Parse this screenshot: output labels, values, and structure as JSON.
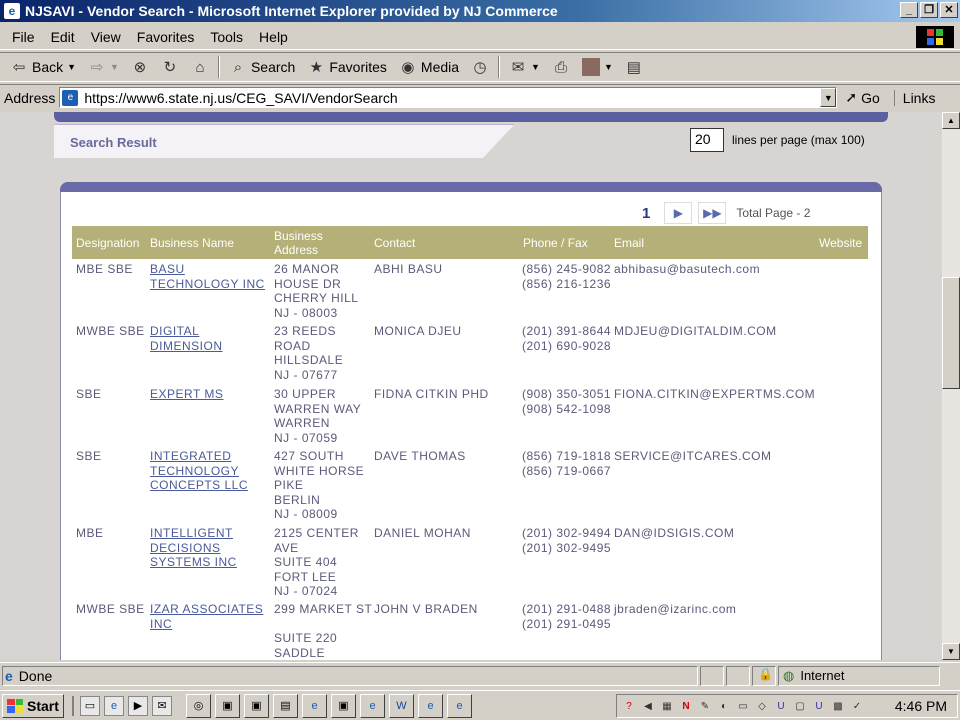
{
  "window": {
    "title": "NJSAVI - Vendor Search - Microsoft Internet Explorer provided by NJ Commerce"
  },
  "menu": [
    "File",
    "Edit",
    "View",
    "Favorites",
    "Tools",
    "Help"
  ],
  "toolbar": {
    "back": "Back",
    "search": "Search",
    "favorites": "Favorites",
    "media": "Media"
  },
  "address": {
    "label": "Address",
    "url": "https://www6.state.nj.us/CEG_SAVI/VendorSearch",
    "go": "Go",
    "links": "Links"
  },
  "page": {
    "section_title": "Search Result",
    "lines_per_page_value": "20",
    "lines_per_page_label": "lines per page (max 100)",
    "current_page": "1",
    "total_pages": "Total Page - 2"
  },
  "table": {
    "headers": [
      "Designation",
      "Business Name",
      "Business Address",
      "Contact",
      "Phone / Fax",
      "Email",
      "Website"
    ],
    "rows": [
      {
        "designation": "MBE SBE",
        "name": [
          "BASU",
          "TECHNOLOGY INC"
        ],
        "address": [
          "26 MANOR",
          "HOUSE DR",
          "CHERRY HILL",
          "NJ - 08003"
        ],
        "contact": "ABHI  BASU",
        "phones": [
          "(856) 245-9082",
          "(856) 216-1236"
        ],
        "email": "abhibasu@basutech.com"
      },
      {
        "designation": "MWBE SBE",
        "name": [
          "DIGITAL",
          "DIMENSION"
        ],
        "address": [
          "23 REEDS",
          "ROAD",
          "HILLSDALE",
          "NJ - 07677"
        ],
        "contact": "MONICA  DJEU",
        "phones": [
          "(201) 391-8644",
          "(201) 690-9028"
        ],
        "email": "MDJEU@DIGITALDIM.COM"
      },
      {
        "designation": "SBE",
        "name": [
          "EXPERT MS"
        ],
        "address": [
          "30 UPPER",
          "WARREN WAY",
          "WARREN",
          "NJ - 07059"
        ],
        "contact": "FIDNA  CITKIN PHD",
        "phones": [
          "(908) 350-3051",
          "(908) 542-1098"
        ],
        "email": "FIONA.CITKIN@EXPERTMS.COM"
      },
      {
        "designation": "SBE",
        "name": [
          "INTEGRATED",
          "TECHNOLOGY",
          "CONCEPTS LLC"
        ],
        "address": [
          "427 SOUTH",
          "WHITE HORSE",
          "PIKE",
          "BERLIN",
          "NJ - 08009"
        ],
        "contact": "DAVE  THOMAS",
        "phones": [
          "(856) 719-1818",
          "(856) 719-0667"
        ],
        "email": "SERVICE@ITCARES.COM"
      },
      {
        "designation": "MBE",
        "name": [
          "INTELLIGENT",
          "DECISIONS",
          "SYSTEMS INC"
        ],
        "address": [
          "2125 CENTER",
          "AVE",
          "SUITE 404",
          "FORT LEE",
          "NJ - 07024"
        ],
        "contact": "DANIEL  MOHAN",
        "phones": [
          "(201) 302-9494",
          "(201) 302-9495"
        ],
        "email": "DAN@IDSIGIS.COM"
      },
      {
        "designation": "MWBE SBE",
        "name": [
          "IZAR ASSOCIATES",
          "INC"
        ],
        "address": [
          "299 MARKET ST",
          "",
          "SUITE 220",
          "SADDLE"
        ],
        "contact": "JOHN V BRADEN",
        "phones": [
          "(201) 291-0488",
          "(201) 291-0495"
        ],
        "email": "jbraden@izarinc.com"
      }
    ]
  },
  "status": {
    "text": "Done",
    "zone": "Internet"
  },
  "taskbar": {
    "start": "Start",
    "clock": "4:46 PM"
  },
  "colors": {
    "header_bg": "#b4b077",
    "link": "#4a5a9a",
    "title_gradient_start": "#0a246a"
  }
}
